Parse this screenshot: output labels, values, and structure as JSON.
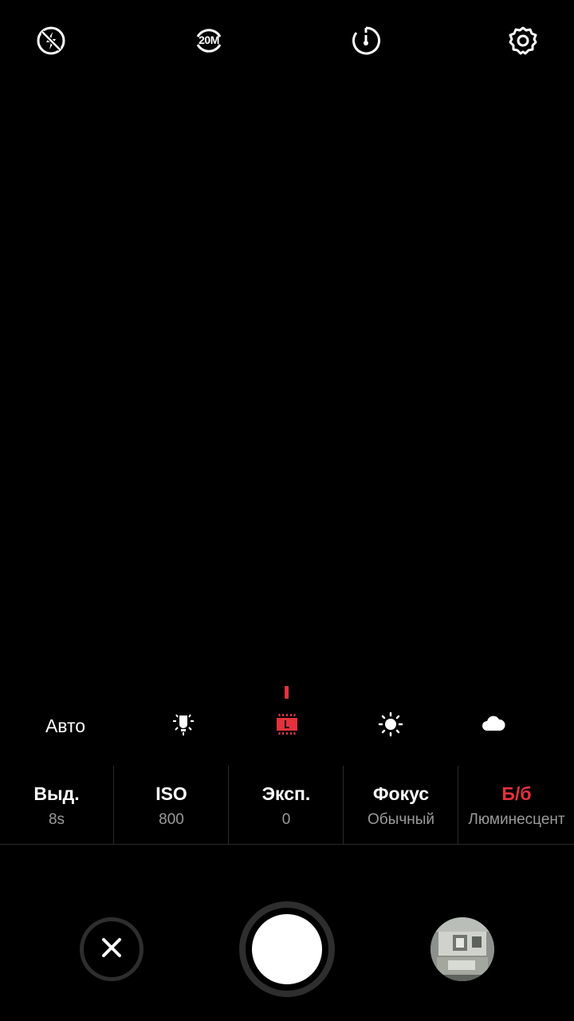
{
  "top_bar": {
    "flash_icon": "flash-off-icon",
    "resolution_icon": "resolution-icon",
    "resolution_label": "20M",
    "timer_icon": "timer-icon",
    "settings_icon": "gear-icon"
  },
  "white_balance": {
    "auto_label": "Авто",
    "options": [
      "auto",
      "incandescent-icon",
      "fluorescent-icon",
      "sunny-icon",
      "cloudy-icon"
    ],
    "selected": "fluorescent-icon",
    "accent_color": "#e3323b"
  },
  "settings": [
    {
      "label": "Выд.",
      "value": "8s"
    },
    {
      "label": "ISO",
      "value": "800"
    },
    {
      "label": "Эксп.",
      "value": "0"
    },
    {
      "label": "Фокус",
      "value": "Обычный"
    },
    {
      "label": "Б/б",
      "value": "Люминесцент"
    }
  ],
  "bottom": {
    "close_icon": "close-icon",
    "shutter": "shutter-button",
    "gallery": "gallery-thumbnail"
  }
}
